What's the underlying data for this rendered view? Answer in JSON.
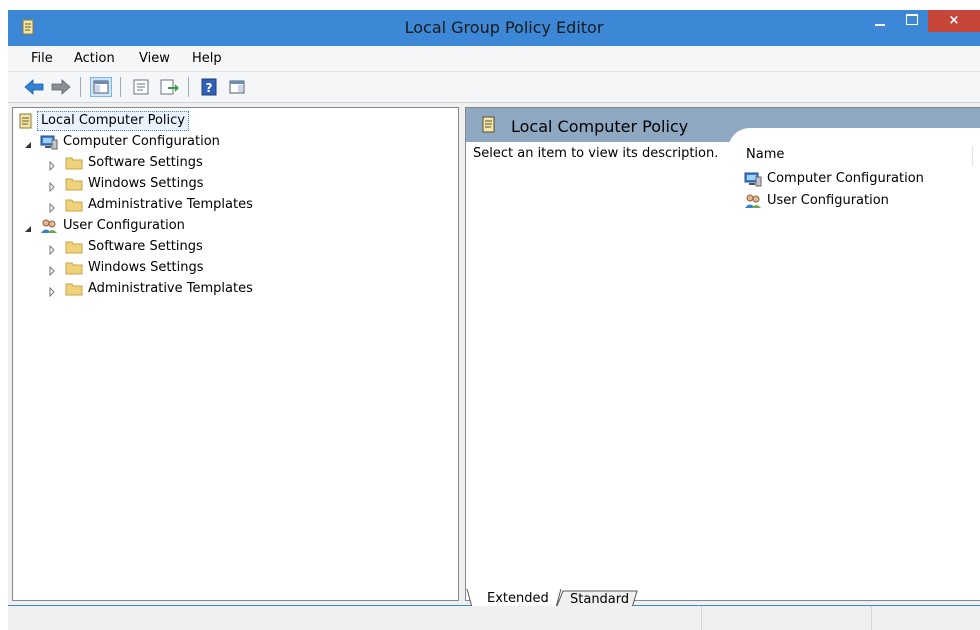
{
  "window": {
    "title": "Local Group Policy Editor",
    "close_glyph": "×"
  },
  "menu": [
    {
      "label": "File"
    },
    {
      "label": "Action"
    },
    {
      "label": "View"
    },
    {
      "label": "Help"
    }
  ],
  "toolbar": {
    "buttons": [
      "back-arrow-icon",
      "forward-arrow-icon",
      "show-hide-tree-icon",
      "properties-icon",
      "export-list-icon",
      "help-icon",
      "show-hide-action-pane-icon"
    ]
  },
  "tree": {
    "root": "Local Computer Policy",
    "computer": {
      "label": "Computer Configuration",
      "children": [
        "Software Settings",
        "Windows Settings",
        "Administrative Templates"
      ]
    },
    "user": {
      "label": "User Configuration",
      "children": [
        "Software Settings",
        "Windows Settings",
        "Administrative Templates"
      ]
    }
  },
  "details": {
    "title": "Local Computer Policy",
    "description": "Select an item to view its description.",
    "column_name": "Name",
    "items": [
      "Computer Configuration",
      "User Configuration"
    ]
  },
  "tabs": {
    "extended": "Extended",
    "standard": "Standard"
  },
  "colors": {
    "titlebar": "#3c87d6",
    "close_button": "#c7463a",
    "header_band": "#8fa8c1"
  }
}
